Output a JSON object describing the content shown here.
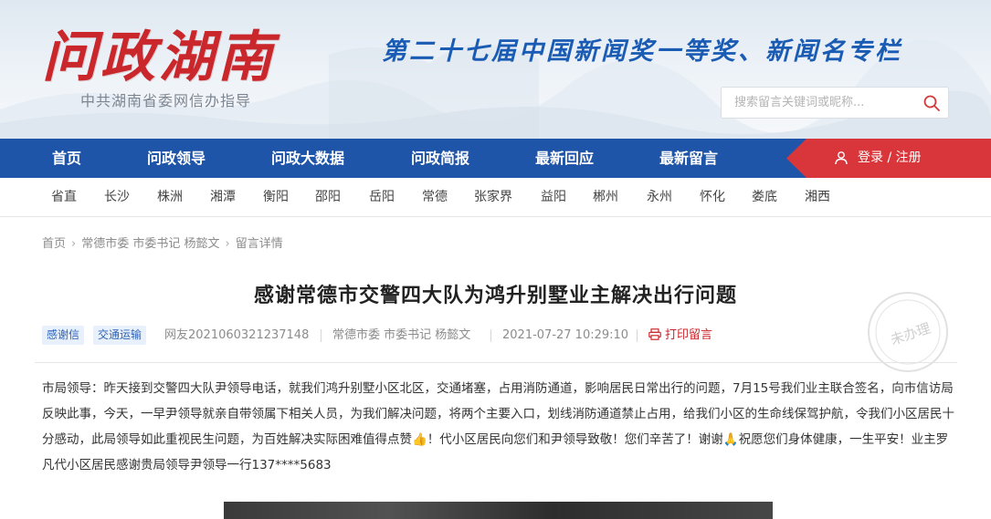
{
  "header": {
    "logo": "问政湖南",
    "logo_sub": "中共湖南省委网信办指导",
    "slogan": "第二十七届中国新闻奖一等奖、新闻名专栏",
    "search_placeholder": "搜索留言关键词或昵称..."
  },
  "nav": {
    "items": [
      "首页",
      "问政领导",
      "问政大数据",
      "问政简报",
      "最新回应",
      "最新留言"
    ],
    "login_label": "登录 / 注册"
  },
  "regions": [
    "省直",
    "长沙",
    "株洲",
    "湘潭",
    "衡阳",
    "邵阳",
    "岳阳",
    "常德",
    "张家界",
    "益阳",
    "郴州",
    "永州",
    "怀化",
    "娄底",
    "湘西"
  ],
  "breadcrumb": [
    "首页",
    "常德市委 市委书记 杨懿文",
    "留言详情"
  ],
  "article": {
    "title": "感谢常德市交警四大队为鸿升别墅业主解决出行问题",
    "tags": [
      "感谢信",
      "交通运输"
    ],
    "user": "网友2021060321237148",
    "target": "常德市委 市委书记 杨懿文",
    "datetime": "2021-07-27 10:29:10",
    "print_label": "打印留言",
    "status_stamp": "未办理",
    "body": "市局领导：昨天接到交警四大队尹领导电话，就我们鸿升别墅小区北区，交通堵塞，占用消防通道，影响居民日常出行的问题，7月15号我们业主联合签名，向市信访局反映此事，今天，一早尹领导就亲自带领属下相关人员，为我们解决问题，将两个主要入口，划线消防通道禁止占用，给我们小区的生命线保驾护航，令我们小区居民十分感动，此局领导如此重视民生问题，为百姓解决实际困难值得点赞👍！代小区居民向您们和尹领导致敬！您们辛苦了！谢谢🙏祝愿您们身体健康，一生平安！业主罗凡代小区居民感谢贵局领导尹领导一行137****5683"
  },
  "colors": {
    "nav_blue": "#1f55a8",
    "login_red": "#d8363a",
    "logo_red": "#c9272c",
    "slogan_blue": "#1a5bb3",
    "tag_blue": "#2f63b6"
  }
}
